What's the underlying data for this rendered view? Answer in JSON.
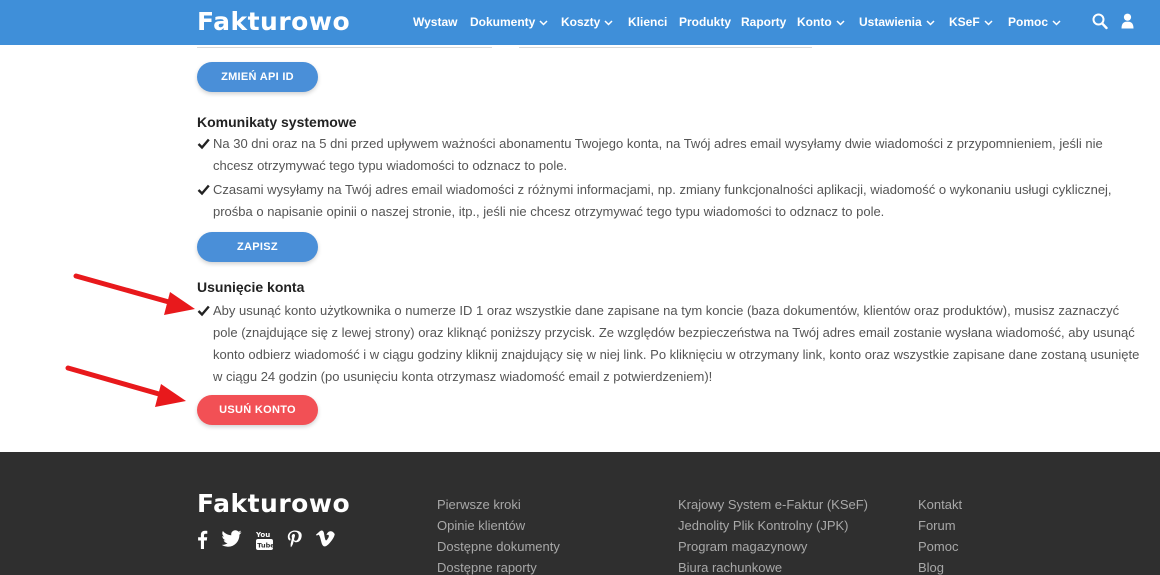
{
  "header": {
    "logo": "Fakturowo",
    "nav": [
      {
        "label": "Wystaw",
        "dropdown": false
      },
      {
        "label": "Dokumenty",
        "dropdown": true
      },
      {
        "label": "Koszty",
        "dropdown": true
      },
      {
        "label": "Klienci",
        "dropdown": false
      },
      {
        "label": "Produkty",
        "dropdown": false
      },
      {
        "label": "Raporty",
        "dropdown": false
      },
      {
        "label": "Konto",
        "dropdown": true
      },
      {
        "label": "Ustawienia",
        "dropdown": true
      },
      {
        "label": "KSeF",
        "dropdown": true
      },
      {
        "label": "Pomoc",
        "dropdown": true
      }
    ],
    "icons": [
      "search-icon",
      "user-icon"
    ]
  },
  "api": {
    "change_button": "ZMIEŃ API ID"
  },
  "system_messages": {
    "title": "Komunikaty systemowe",
    "options": [
      {
        "checked": true,
        "text": "Na 30 dni oraz na 5 dni przed upływem ważności abonamentu Twojego konta, na Twój adres email wysyłamy dwie wiadomości z przypomnieniem, jeśli nie chcesz otrzymywać tego typu wiadomości to odznacz to pole."
      },
      {
        "checked": true,
        "text": "Czasami wysyłamy na Twój adres email wiadomości z różnymi informacjami, np. zmiany funkcjonalności aplikacji, wiadomość o wykonaniu usługi cyklicznej, prośba o napisanie opinii o naszej stronie, itp., jeśli nie chcesz otrzymywać tego typu wiadomości to odznacz to pole."
      }
    ],
    "save_button": "ZAPISZ"
  },
  "delete_account": {
    "title": "Usunięcie konta",
    "checked": true,
    "text": "Aby usunąć konto użytkownika o numerze ID 1 oraz wszystkie dane zapisane na tym koncie (baza dokumentów, klientów oraz produktów), musisz zaznaczyć pole (znajdujące się z lewej strony) oraz kliknąć poniższy przycisk. Ze względów bezpieczeństwa na Twój adres email zostanie wysłana wiadomość, aby usunąć konto odbierz wiadomość i w ciągu godziny kliknij znajdujący się w niej link. Po kliknięciu w otrzymany link, konto oraz wszystkie zapisane dane zostaną usunięte w ciągu 24 godzin (po usunięciu konta otrzymasz wiadomość email z potwierdzeniem)!",
    "button": "USUŃ KONTO"
  },
  "footer": {
    "logo": "Fakturowo",
    "social": [
      "facebook-icon",
      "twitter-icon",
      "youtube-icon",
      "pinterest-icon",
      "vimeo-icon"
    ],
    "columns": [
      [
        "Pierwsze kroki",
        "Opinie klientów",
        "Dostępne dokumenty",
        "Dostępne raporty"
      ],
      [
        "Krajowy System e-Faktur (KSeF)",
        "Jednolity Plik Kontrolny (JPK)",
        "Program magazynowy",
        "Biura rachunkowe"
      ],
      [
        "Kontakt",
        "Forum",
        "Pomoc",
        "Blog"
      ]
    ]
  },
  "colors": {
    "header_bg": "#3f8fd9",
    "button_blue": "#4a8fd8",
    "button_red": "#f25055",
    "arrow_red": "#e8191c",
    "footer_bg": "#2f2f2f"
  }
}
